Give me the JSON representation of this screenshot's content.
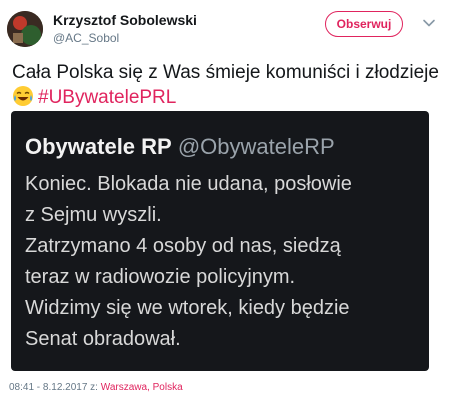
{
  "author": {
    "name": "Krzysztof Sobolewski",
    "handle": "@AC_Sobol"
  },
  "follow_label": "Obserwuj",
  "tweet": {
    "text": "Cała Polska się z Was śmieje komuniści i złodzieje",
    "emoji": "face-with-tears-of-joy",
    "hashtag": "#UBywatelePRL"
  },
  "embedded": {
    "display_name": "Obywatele RP",
    "handle": "@ObywateleRP",
    "lines": [
      "Koniec. Blokada nie udana, posłowie",
      "z Sejmu wyszli.",
      "Zatrzymano 4 osoby od nas, siedzą",
      "teraz w radiowozie policyjnym.",
      "Widzimy się we wtorek, kiedy będzie",
      "Senat obradował."
    ]
  },
  "meta": {
    "time": "08:41 - 8.12.2017 z:",
    "location_prefix": "Warszawa,",
    "location_suffix": "Polska"
  },
  "colors": {
    "accent": "#e0245e",
    "muted": "#657786",
    "media_bg": "#15171b"
  }
}
